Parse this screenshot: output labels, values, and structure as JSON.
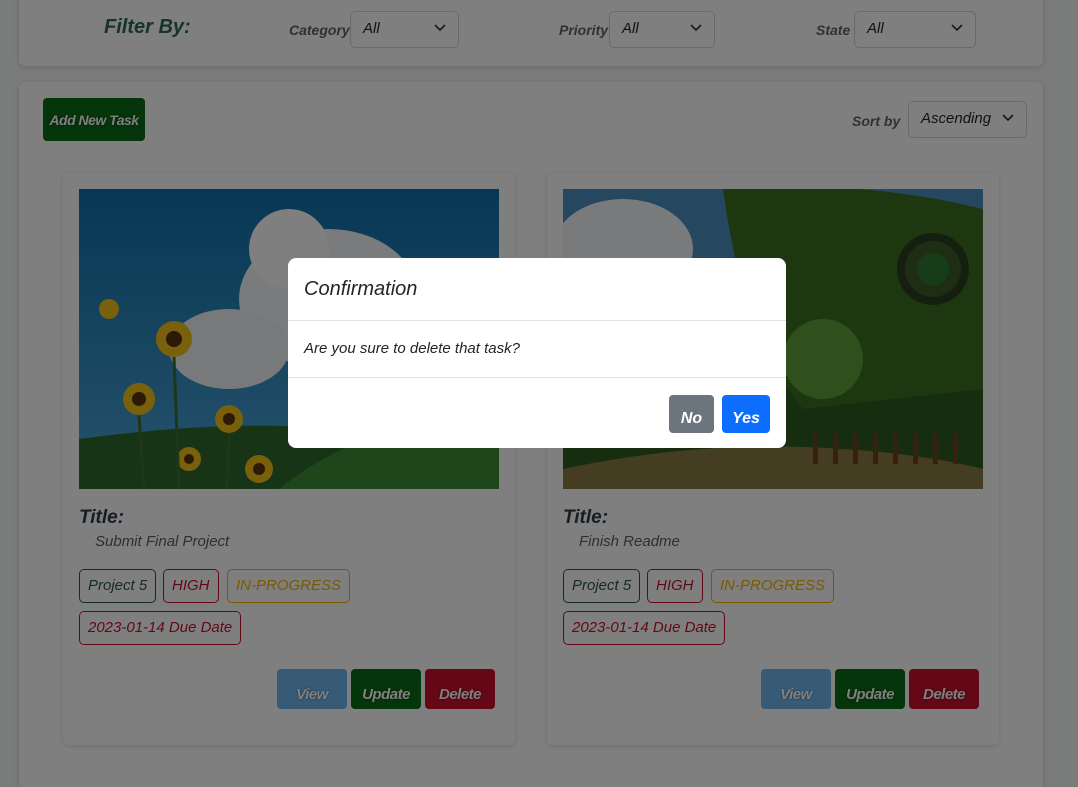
{
  "filter": {
    "title": "Filter By:",
    "category_label": "Category",
    "category_value": "All",
    "priority_label": "Priority",
    "priority_value": "All",
    "state_label": "State",
    "state_value": "All"
  },
  "toolbar": {
    "add_label": "Add New Task",
    "sort_label": "Sort by",
    "sort_value": "Ascending"
  },
  "tasks": [
    {
      "title_label": "Title:",
      "title": "Submit Final Project",
      "project": "Project 5",
      "priority": "HIGH",
      "state": "IN-PROGRESS",
      "due": "2023-01-14 Due Date",
      "view_label": "View",
      "update_label": "Update",
      "delete_label": "Delete"
    },
    {
      "title_label": "Title:",
      "title": "Finish Readme",
      "project": "Project 5",
      "priority": "HIGH",
      "state": "IN-PROGRESS",
      "due": "2023-01-14 Due Date",
      "view_label": "View",
      "update_label": "Update",
      "delete_label": "Delete"
    }
  ],
  "modal": {
    "title": "Confirmation",
    "message": "Are you sure to delete that task?",
    "no_label": "No",
    "yes_label": "Yes"
  },
  "colors": {
    "accent_green": "#0b6a16",
    "danger_red": "#c8102e",
    "info_blue": "#6fb6ee",
    "warning_yellow": "#f0b400",
    "primary_blue": "#0d6efd",
    "secondary_gray": "#6c757d"
  }
}
